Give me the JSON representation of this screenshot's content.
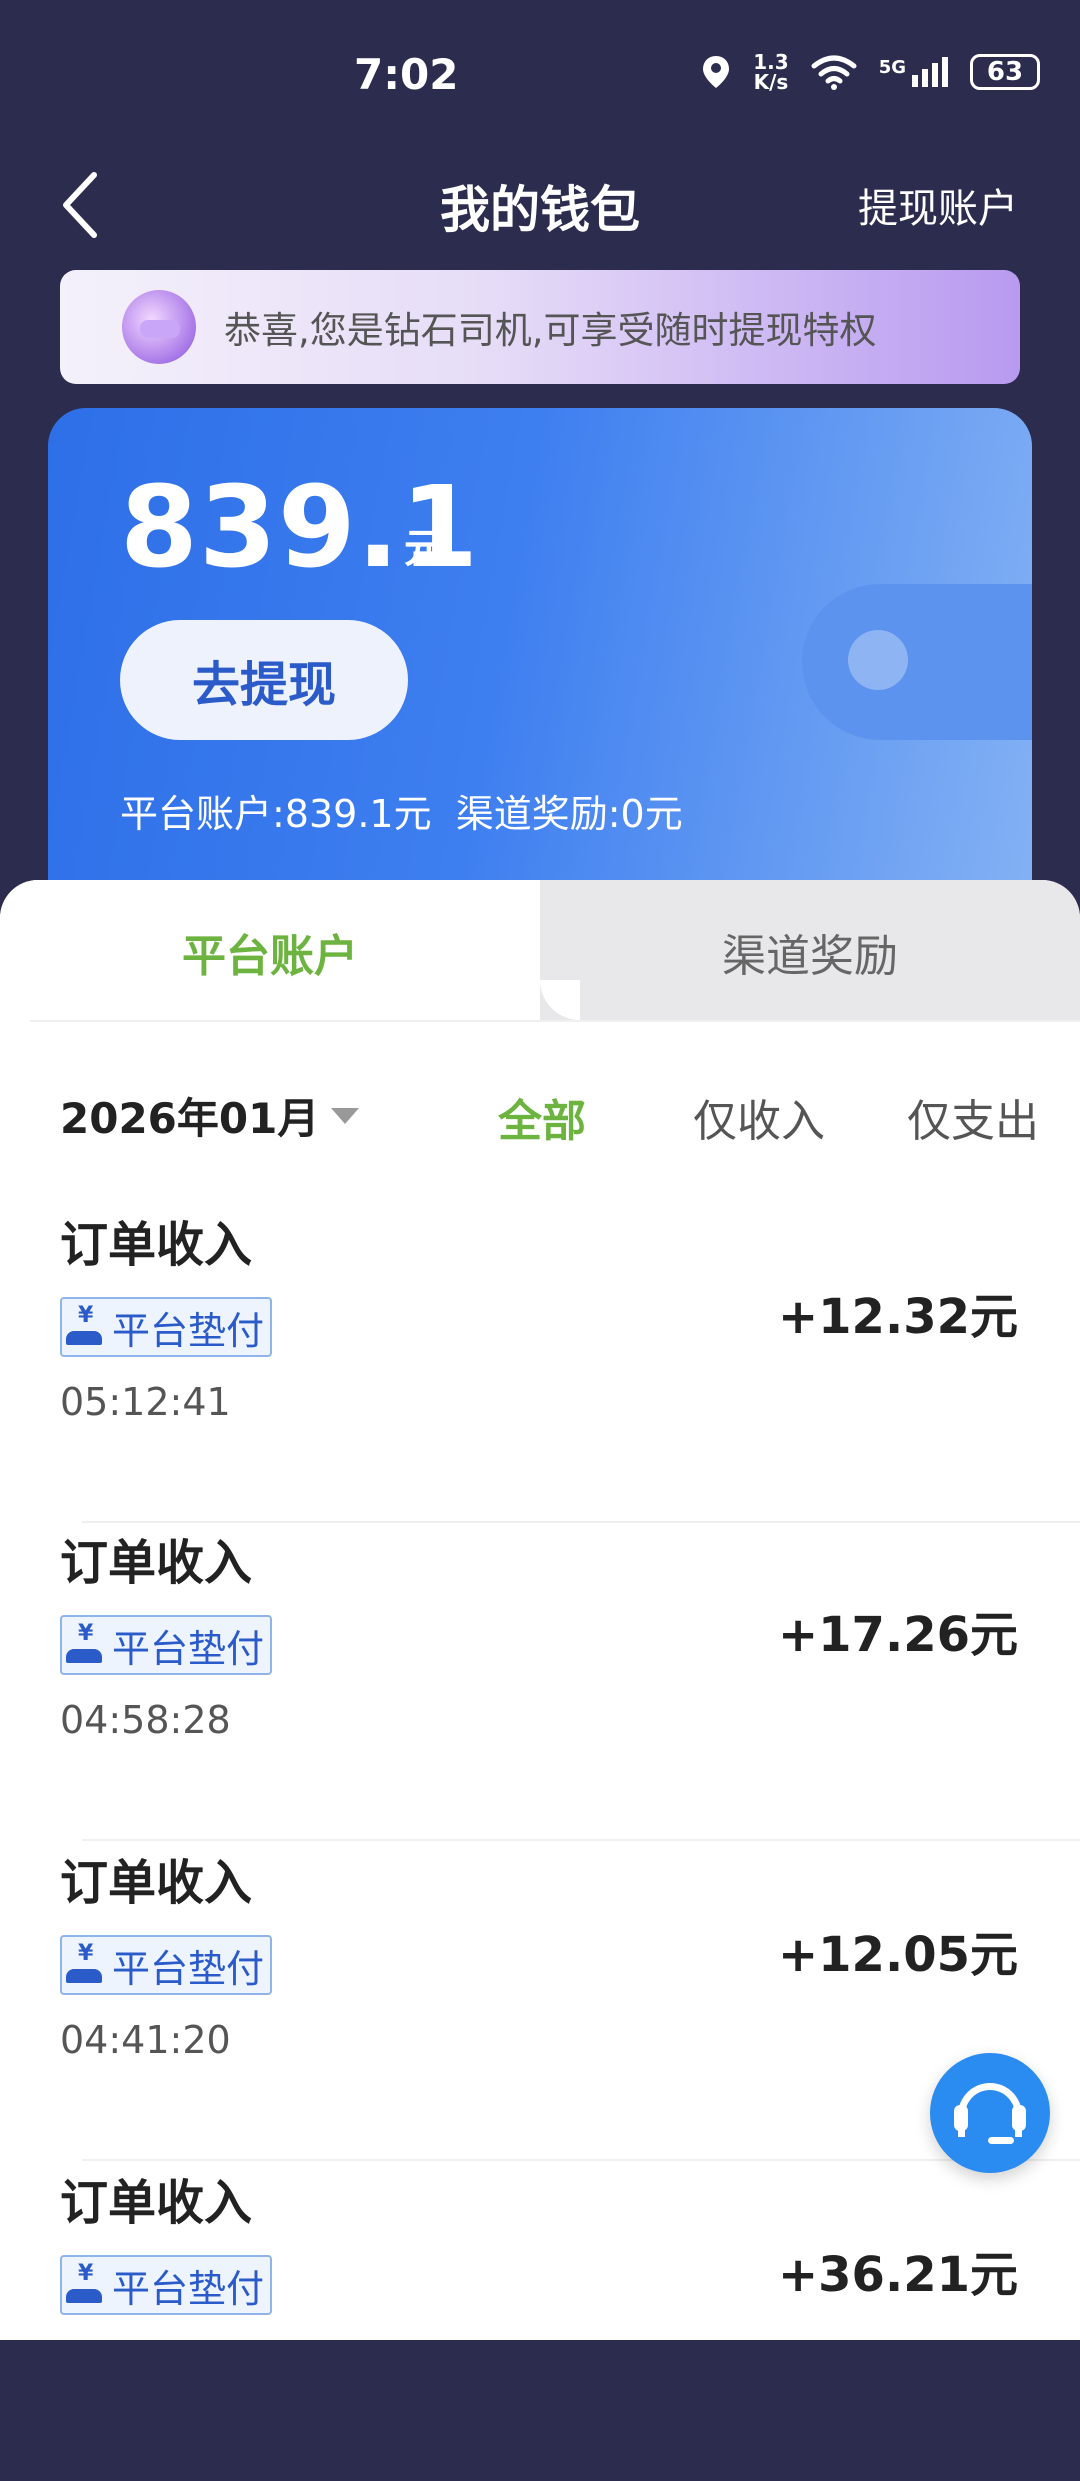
{
  "status": {
    "time": "7:02",
    "speed_top": "1.3",
    "speed_bottom": "K/s",
    "network": "5G",
    "battery": "63"
  },
  "header": {
    "title": "我的钱包",
    "right_action": "提现账户"
  },
  "banner": {
    "text": "恭喜,您是钻石司机,可享受随时提现特权"
  },
  "balance": {
    "amount": "839.1",
    "unit": "元",
    "withdraw_label": "去提现",
    "detail": "平台账户:839.1元  渠道奖励:0元"
  },
  "tabs": [
    {
      "label": "平台账户",
      "active": true
    },
    {
      "label": "渠道奖励",
      "active": false
    }
  ],
  "filter": {
    "month": "2026年01月",
    "options": [
      "全部",
      "仅收入",
      "仅支出"
    ],
    "selected": "全部"
  },
  "transactions": [
    {
      "title": "订单收入",
      "tag": "平台垫付",
      "time": "05:12:41",
      "amount": "+12.32元"
    },
    {
      "title": "订单收入",
      "tag": "平台垫付",
      "time": "04:58:28",
      "amount": "+17.26元"
    },
    {
      "title": "订单收入",
      "tag": "平台垫付",
      "time": "04:41:20",
      "amount": "+12.05元"
    },
    {
      "title": "订单收入",
      "tag": "平台垫付",
      "time": "",
      "amount": "+36.21元"
    }
  ],
  "colors": {
    "accent_green": "#6db33f",
    "card_blue": "#3d7ef0",
    "tag_blue": "#2a5bc9",
    "header_bg": "#2c2d4e"
  },
  "icons": [
    "back-arrow-icon",
    "location-icon",
    "wifi-icon",
    "signal-icon",
    "battery-icon",
    "car-icon",
    "wallet-icon",
    "yen-hand-icon",
    "headset-icon",
    "caret-down-icon"
  ]
}
